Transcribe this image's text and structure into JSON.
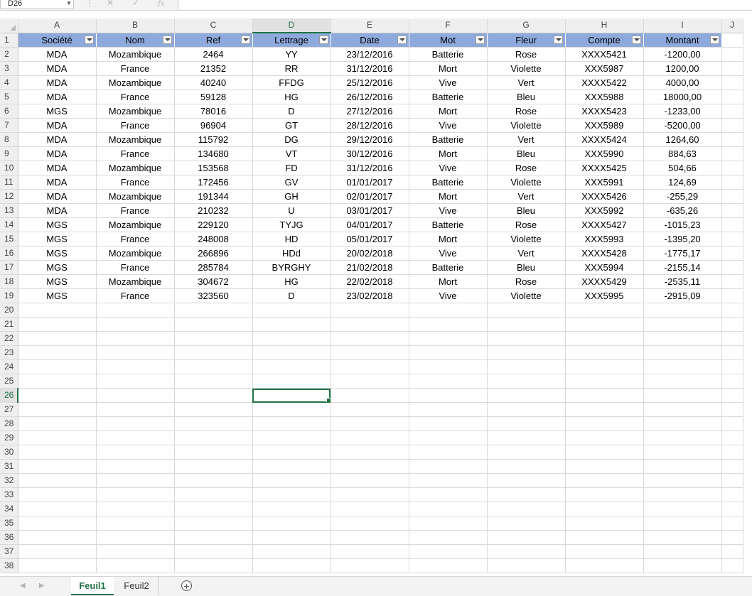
{
  "formula_bar": {
    "name_box": "D26",
    "cancel_icon": "✕",
    "enter_icon": "✓",
    "fx_label": "fx",
    "formula": ""
  },
  "columns": [
    "A",
    "B",
    "C",
    "D",
    "E",
    "F",
    "G",
    "H",
    "I",
    "J"
  ],
  "selected_column": "D",
  "selected_row": 26,
  "selected_cell": "D26",
  "header_fill_color": "#8eaadc",
  "accent_color": "#217346",
  "table": {
    "headers": [
      "Société",
      "Nom",
      "Ref",
      "Lettrage",
      "Date",
      "Mot",
      "Fleur",
      "Compte",
      "Montant"
    ],
    "rows": [
      [
        "MDA",
        "Mozambique",
        "2464",
        "YY",
        "23/12/2016",
        "Batterie",
        "Rose",
        "XXXX5421",
        "-1200,00"
      ],
      [
        "MDA",
        "France",
        "21352",
        "RR",
        "31/12/2016",
        "Mort",
        "Violette",
        "XXX5987",
        "1200,00"
      ],
      [
        "MDA",
        "Mozambique",
        "40240",
        "FFDG",
        "25/12/2016",
        "Vive",
        "Vert",
        "XXXX5422",
        "4000,00"
      ],
      [
        "MDA",
        "France",
        "59128",
        "HG",
        "26/12/2016",
        "Batterie",
        "Bleu",
        "XXX5988",
        "18000,00"
      ],
      [
        "MGS",
        "Mozambique",
        "78016",
        "D",
        "27/12/2016",
        "Mort",
        "Rose",
        "XXXX5423",
        "-1233,00"
      ],
      [
        "MDA",
        "France",
        "96904",
        "GT",
        "28/12/2016",
        "Vive",
        "Violette",
        "XXX5989",
        "-5200,00"
      ],
      [
        "MDA",
        "Mozambique",
        "115792",
        "DG",
        "29/12/2016",
        "Batterie",
        "Vert",
        "XXXX5424",
        "1264,60"
      ],
      [
        "MDA",
        "France",
        "134680",
        "VT",
        "30/12/2016",
        "Mort",
        "Bleu",
        "XXX5990",
        "884,63"
      ],
      [
        "MDA",
        "Mozambique",
        "153568",
        "FD",
        "31/12/2016",
        "Vive",
        "Rose",
        "XXXX5425",
        "504,66"
      ],
      [
        "MDA",
        "France",
        "172456",
        "GV",
        "01/01/2017",
        "Batterie",
        "Violette",
        "XXX5991",
        "124,69"
      ],
      [
        "MDA",
        "Mozambique",
        "191344",
        "GH",
        "02/01/2017",
        "Mort",
        "Vert",
        "XXXX5426",
        "-255,29"
      ],
      [
        "MDA",
        "France",
        "210232",
        "U",
        "03/01/2017",
        "Vive",
        "Bleu",
        "XXX5992",
        "-635,26"
      ],
      [
        "MGS",
        "Mozambique",
        "229120",
        "TYJG",
        "04/01/2017",
        "Batterie",
        "Rose",
        "XXXX5427",
        "-1015,23"
      ],
      [
        "MGS",
        "France",
        "248008",
        "HD",
        "05/01/2017",
        "Mort",
        "Violette",
        "XXX5993",
        "-1395,20"
      ],
      [
        "MGS",
        "Mozambique",
        "266896",
        "HDd",
        "20/02/2018",
        "Vive",
        "Vert",
        "XXXX5428",
        "-1775,17"
      ],
      [
        "MGS",
        "France",
        "285784",
        "BYRGHY",
        "21/02/2018",
        "Batterie",
        "Bleu",
        "XXX5994",
        "-2155,14"
      ],
      [
        "MGS",
        "Mozambique",
        "304672",
        "HG",
        "22/02/2018",
        "Mort",
        "Rose",
        "XXXX5429",
        "-2535,11"
      ],
      [
        "MGS",
        "France",
        "323560",
        "D",
        "23/02/2018",
        "Vive",
        "Violette",
        "XXX5995",
        "-2915,09"
      ]
    ]
  },
  "row_count_visible": 38,
  "sheet_tabs": {
    "tabs": [
      "Feuil1",
      "Feuil2"
    ],
    "active": "Feuil1",
    "add_icon": "+"
  }
}
